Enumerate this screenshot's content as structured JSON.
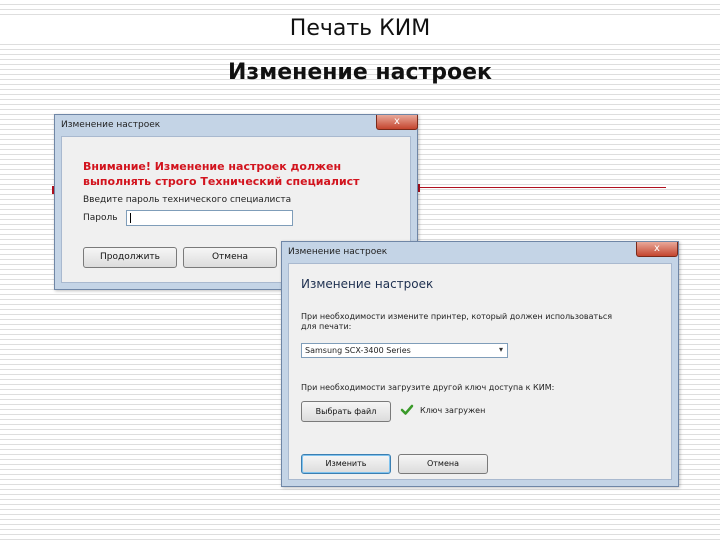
{
  "slide": {
    "title": "Печать КИМ",
    "subtitle": "Изменение настроек"
  },
  "dialog1": {
    "title": "Изменение настроек",
    "close_label": "x",
    "warning_line1": "Внимание! Изменение настроек должен",
    "warning_line2": "выполнять строго  Технический специалист",
    "prompt": "Введите пароль технического специалиста",
    "password_label": "Пароль",
    "password_value": "",
    "continue_label": "Продолжить",
    "cancel_label": "Отмена"
  },
  "dialog2": {
    "title": "Изменение настроек",
    "close_label": "x",
    "heading": "Изменение настроек",
    "printer_prompt_line1": "При необходимости измените принтер, который должен использоваться",
    "printer_prompt_line2": "для печати:",
    "printer_selected": "Samsung SCX-3400 Series",
    "key_prompt": "При необходимости загрузите другой ключ доступа к КИМ:",
    "choose_file_label": "Выбрать файл",
    "key_status": "Ключ загружен",
    "change_label": "Изменить",
    "cancel_label": "Отмена"
  },
  "colors": {
    "warning_text": "#d2141e",
    "accent_line": "#b01020",
    "check_green": "#3a9a2a",
    "window_frame": "#c4d4e6"
  },
  "icons": {
    "close": "close-icon",
    "dropdown": "chevron-down-icon",
    "status": "checkmark-icon"
  }
}
